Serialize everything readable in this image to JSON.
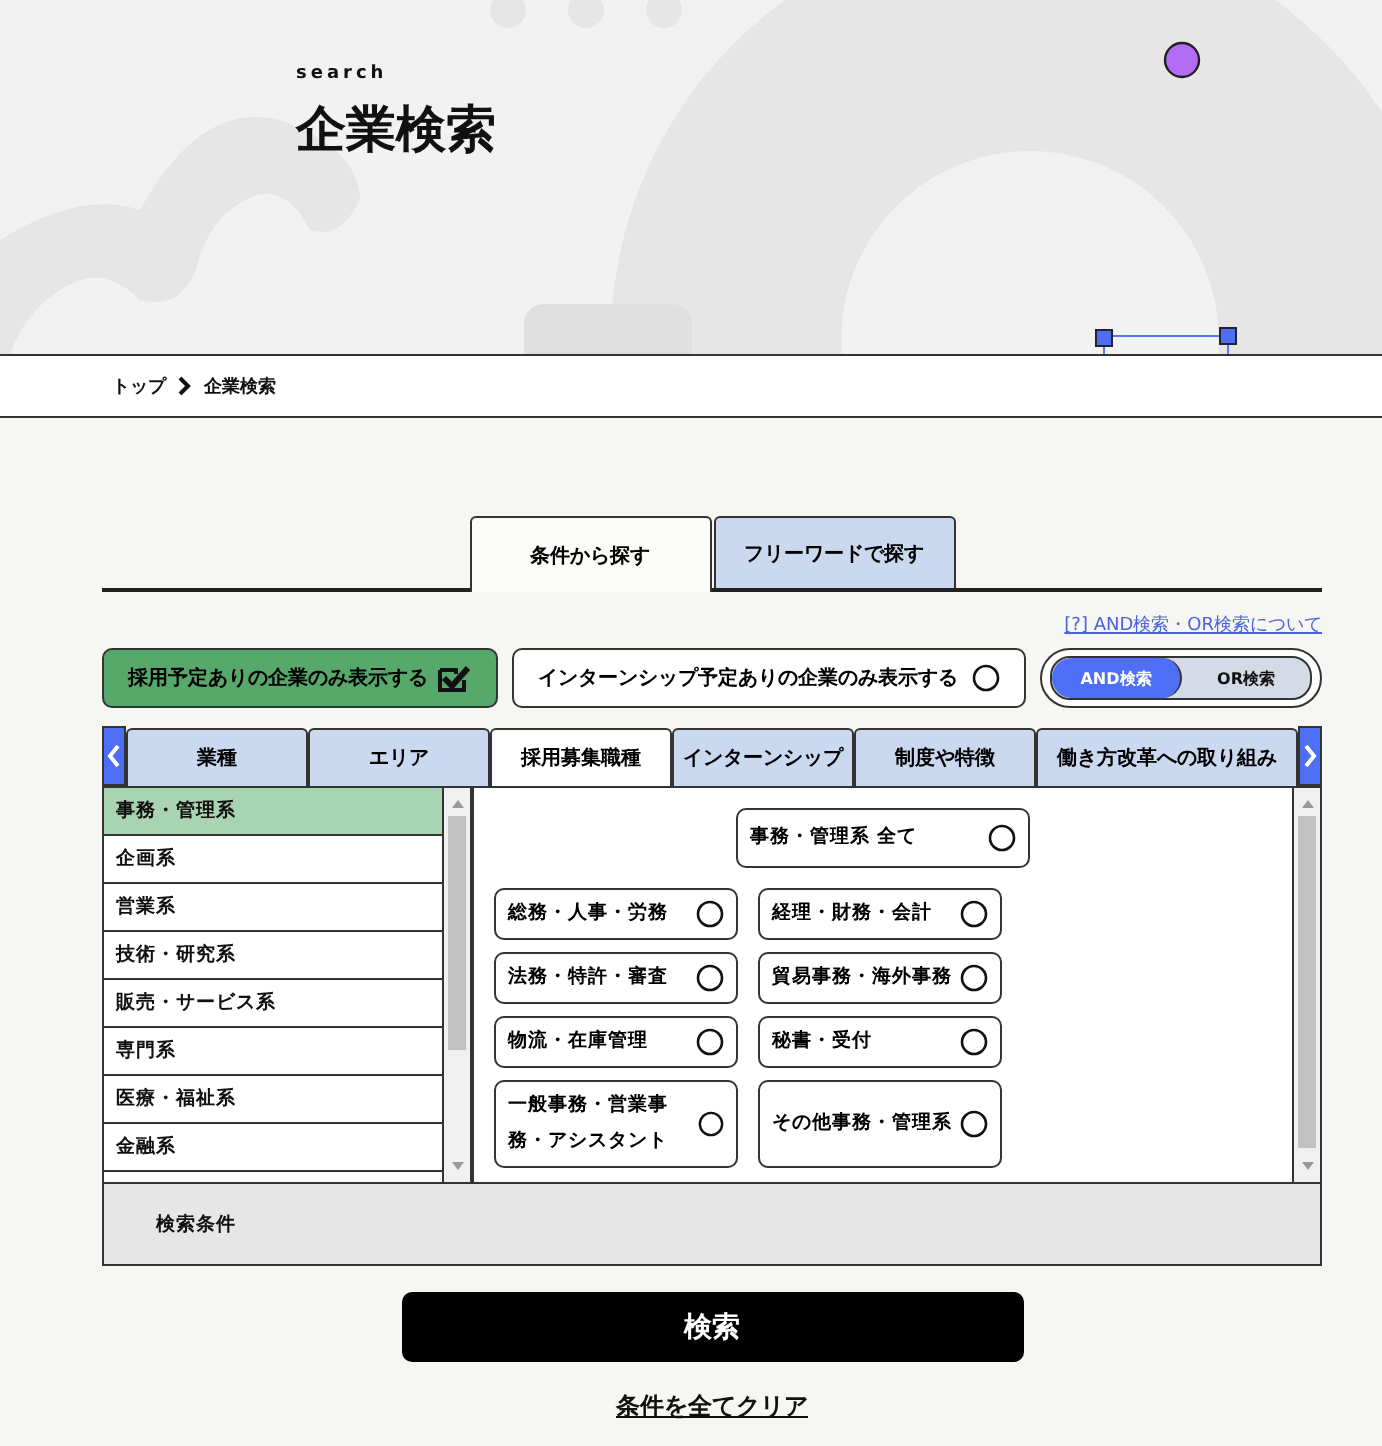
{
  "hero": {
    "eyebrow": "search",
    "title": "企業検索"
  },
  "breadcrumb": [
    {
      "label": "トップ"
    },
    {
      "label": "企業検索"
    }
  ],
  "main_tabs": [
    {
      "label": "条件から探す",
      "selected": true
    },
    {
      "label": "フリーワードで探す",
      "selected": false
    }
  ],
  "help_link": "[?] AND検索・OR検索について",
  "filters": [
    {
      "label": "採用予定ありの企業のみ表示する",
      "checked": true
    },
    {
      "label": "インターンシップ予定ありの企業のみ表示する",
      "checked": false
    }
  ],
  "logic_toggle": [
    {
      "label": "AND検索",
      "selected": true
    },
    {
      "label": "OR検索",
      "selected": false
    }
  ],
  "category_tabs": [
    {
      "label": "業種",
      "selected": false
    },
    {
      "label": "エリア",
      "selected": false
    },
    {
      "label": "採用募集職種",
      "selected": true
    },
    {
      "label": "インターンシップ",
      "selected": false
    },
    {
      "label": "制度や特徴",
      "selected": false
    },
    {
      "label": "働き方改革への取り組み",
      "selected": false
    }
  ],
  "job_groups": [
    {
      "label": "事務・管理系",
      "selected": true
    },
    {
      "label": "企画系",
      "selected": false
    },
    {
      "label": "営業系",
      "selected": false
    },
    {
      "label": "技術・研究系",
      "selected": false
    },
    {
      "label": "販売・サービス系",
      "selected": false
    },
    {
      "label": "専門系",
      "selected": false
    },
    {
      "label": "医療・福祉系",
      "selected": false
    },
    {
      "label": "金融系",
      "selected": false
    }
  ],
  "job_options": [
    {
      "kind": "all",
      "label": "事務・管理系 全て",
      "checked": false
    },
    {
      "kind": "option",
      "label": "総務・人事・労務",
      "checked": false
    },
    {
      "kind": "option",
      "label": "経理・財務・会計",
      "checked": false
    },
    {
      "kind": "option",
      "label": "法務・特許・審査",
      "checked": false
    },
    {
      "kind": "option",
      "label": "貿易事務・海外事務",
      "checked": false
    },
    {
      "kind": "option",
      "label": "物流・在庫管理",
      "checked": false
    },
    {
      "kind": "option",
      "label": "秘書・受付",
      "checked": false
    },
    {
      "kind": "option",
      "label": "一般事務・営業事務・アシスタント",
      "checked": false
    },
    {
      "kind": "option",
      "label": "その他事務・管理系",
      "checked": false
    }
  ],
  "conditions_label": "検索条件",
  "search_button": "検索",
  "clear_link": "条件を全てクリア"
}
